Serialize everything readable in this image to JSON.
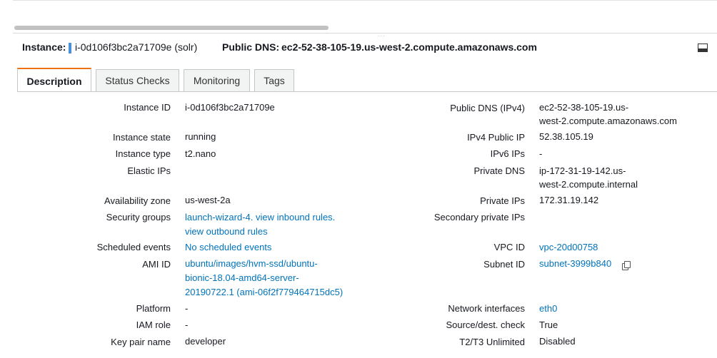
{
  "header": {
    "instance_label": "Instance:",
    "instance_id": "i-0d106f3bc2a71709e (solr)",
    "dns_label": "Public DNS:",
    "dns_value": "ec2-52-38-105-19.us-west-2.compute.amazonaws.com"
  },
  "tabs": [
    {
      "label": "Description"
    },
    {
      "label": "Status Checks"
    },
    {
      "label": "Monitoring"
    },
    {
      "label": "Tags"
    }
  ],
  "left": {
    "instance_id": {
      "label": "Instance ID",
      "value": "i-0d106f3bc2a71709e"
    },
    "instance_state": {
      "label": "Instance state",
      "value": "running"
    },
    "instance_type": {
      "label": "Instance type",
      "value": "t2.nano"
    },
    "elastic_ips": {
      "label": "Elastic IPs",
      "value": ""
    },
    "availability_zone": {
      "label": "Availability zone",
      "value": "us-west-2a"
    },
    "security_groups": {
      "label": "Security groups",
      "value_1": "launch-wizard-4.",
      "link_inbound": "view inbound rules.",
      "link_outbound": "view outbound rules"
    },
    "scheduled_events": {
      "label": "Scheduled events",
      "value": "No scheduled events"
    },
    "ami_id": {
      "label": "AMI ID",
      "line1": "ubuntu/images/hvm-ssd/ubuntu-",
      "line2": "bionic-18.04-amd64-server-",
      "line3": "20190722.1 (ami-06f2f779464715dc5)"
    },
    "platform": {
      "label": "Platform",
      "value": "-"
    },
    "iam_role": {
      "label": "IAM role",
      "value": "-"
    },
    "key_pair": {
      "label": "Key pair name",
      "value": "developer"
    }
  },
  "right": {
    "public_dns": {
      "label": "Public DNS (IPv4)",
      "line1": "ec2-52-38-105-19.us-",
      "line2": "west-2.compute.amazonaws.com"
    },
    "ipv4_public": {
      "label": "IPv4 Public IP",
      "value": "52.38.105.19"
    },
    "ipv6_ips": {
      "label": "IPv6 IPs",
      "value": "-"
    },
    "private_dns": {
      "label": "Private DNS",
      "line1": "ip-172-31-19-142.us-",
      "line2": "west-2.compute.internal"
    },
    "private_ips": {
      "label": "Private IPs",
      "value": "172.31.19.142"
    },
    "secondary_private": {
      "label": "Secondary private IPs",
      "value": ""
    },
    "vpc_id": {
      "label": "VPC ID",
      "value": "vpc-20d00758"
    },
    "subnet_id": {
      "label": "Subnet ID",
      "value": "subnet-3999b840"
    },
    "network_interfaces": {
      "label": "Network interfaces",
      "value": "eth0"
    },
    "source_dest": {
      "label": "Source/dest. check",
      "value": "True"
    },
    "t2t3": {
      "label": "T2/T3 Unlimited",
      "value": "Disabled"
    }
  },
  "icons": {
    "copy": "copy-icon",
    "panel_toggle": "panel-toggle-icon"
  },
  "colors": {
    "link": "#0073bb",
    "tab_accent": "#ec7211",
    "selection_marker": "#4a90d9"
  }
}
